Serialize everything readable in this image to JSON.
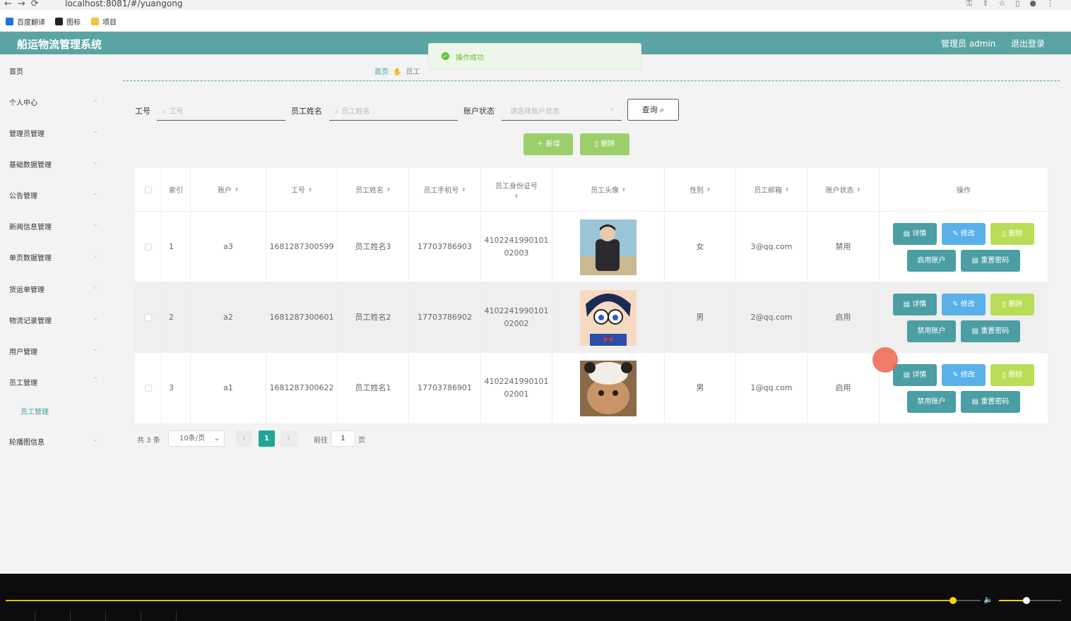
{
  "browser": {
    "url": "localhost:8081/#/yuangong"
  },
  "bookmarks": [
    {
      "label": "百度翻译",
      "color": "#1a73e8"
    },
    {
      "label": "图标",
      "color": "#222222"
    },
    {
      "label": "项目",
      "color": "#f4c542"
    }
  ],
  "header": {
    "title": "船运物流管理系统",
    "user": "管理员 admin",
    "logout": "退出登录"
  },
  "sidebar": {
    "items": [
      "首页",
      "个人中心",
      "管理员管理",
      "基础数据管理",
      "公告管理",
      "新闻信息管理",
      "单页数据管理",
      "货运单管理",
      "物流记录管理",
      "用户管理",
      "员工管理",
      "轮播图信息"
    ],
    "sub_item": "员工管理"
  },
  "toast": {
    "message": "操作成功"
  },
  "breadcrumb": {
    "home": "首页",
    "current": "员工"
  },
  "filters": {
    "id_label": "工号",
    "id_placeholder": "工号",
    "name_label": "员工姓名",
    "name_placeholder": "员工姓名",
    "status_label": "账户状态",
    "status_placeholder": "请选择账户状态",
    "query": "查询"
  },
  "actions": {
    "add": "＋ 新增",
    "delete": "删除"
  },
  "table": {
    "headers": [
      "索引",
      "账户",
      "工号",
      "员工姓名",
      "员工手机号",
      "员工身份证号",
      "员工头像",
      "性别",
      "员工邮箱",
      "账户状态",
      "操作"
    ],
    "rows": [
      {
        "index": "1",
        "account": "a3",
        "id": "1681287300599",
        "name": "员工姓名3",
        "phone": "17703786903",
        "idcard1": "4102241990101",
        "idcard2": "02003",
        "gender": "女",
        "email": "3@qq.com",
        "status": "禁用",
        "toggle": "启用账户"
      },
      {
        "index": "2",
        "account": "a2",
        "id": "1681287300601",
        "name": "员工姓名2",
        "phone": "17703786902",
        "idcard1": "4102241990101",
        "idcard2": "02002",
        "gender": "男",
        "email": "2@qq.com",
        "status": "启用",
        "toggle": "禁用账户"
      },
      {
        "index": "3",
        "account": "a1",
        "id": "1681287300622",
        "name": "员工姓名1",
        "phone": "17703786901",
        "idcard1": "4102241990101",
        "idcard2": "02001",
        "gender": "男",
        "email": "1@qq.com",
        "status": "启用",
        "toggle": "禁用账户"
      }
    ],
    "btn_detail": "详情",
    "btn_edit": "修改",
    "btn_delete": "删除",
    "btn_reset": "重置密码"
  },
  "pagination": {
    "total": "共 3 条",
    "page_size": "10条/页",
    "current": "1",
    "goto": "前往",
    "goto_value": "1",
    "page_unit": "页"
  },
  "colors": {
    "brand": "#5aa4a5",
    "success": "#67c23a",
    "edit": "#5ab1ea",
    "delete": "#b9dd56"
  },
  "player": {
    "progress": 0.89,
    "volume": 0.4
  }
}
